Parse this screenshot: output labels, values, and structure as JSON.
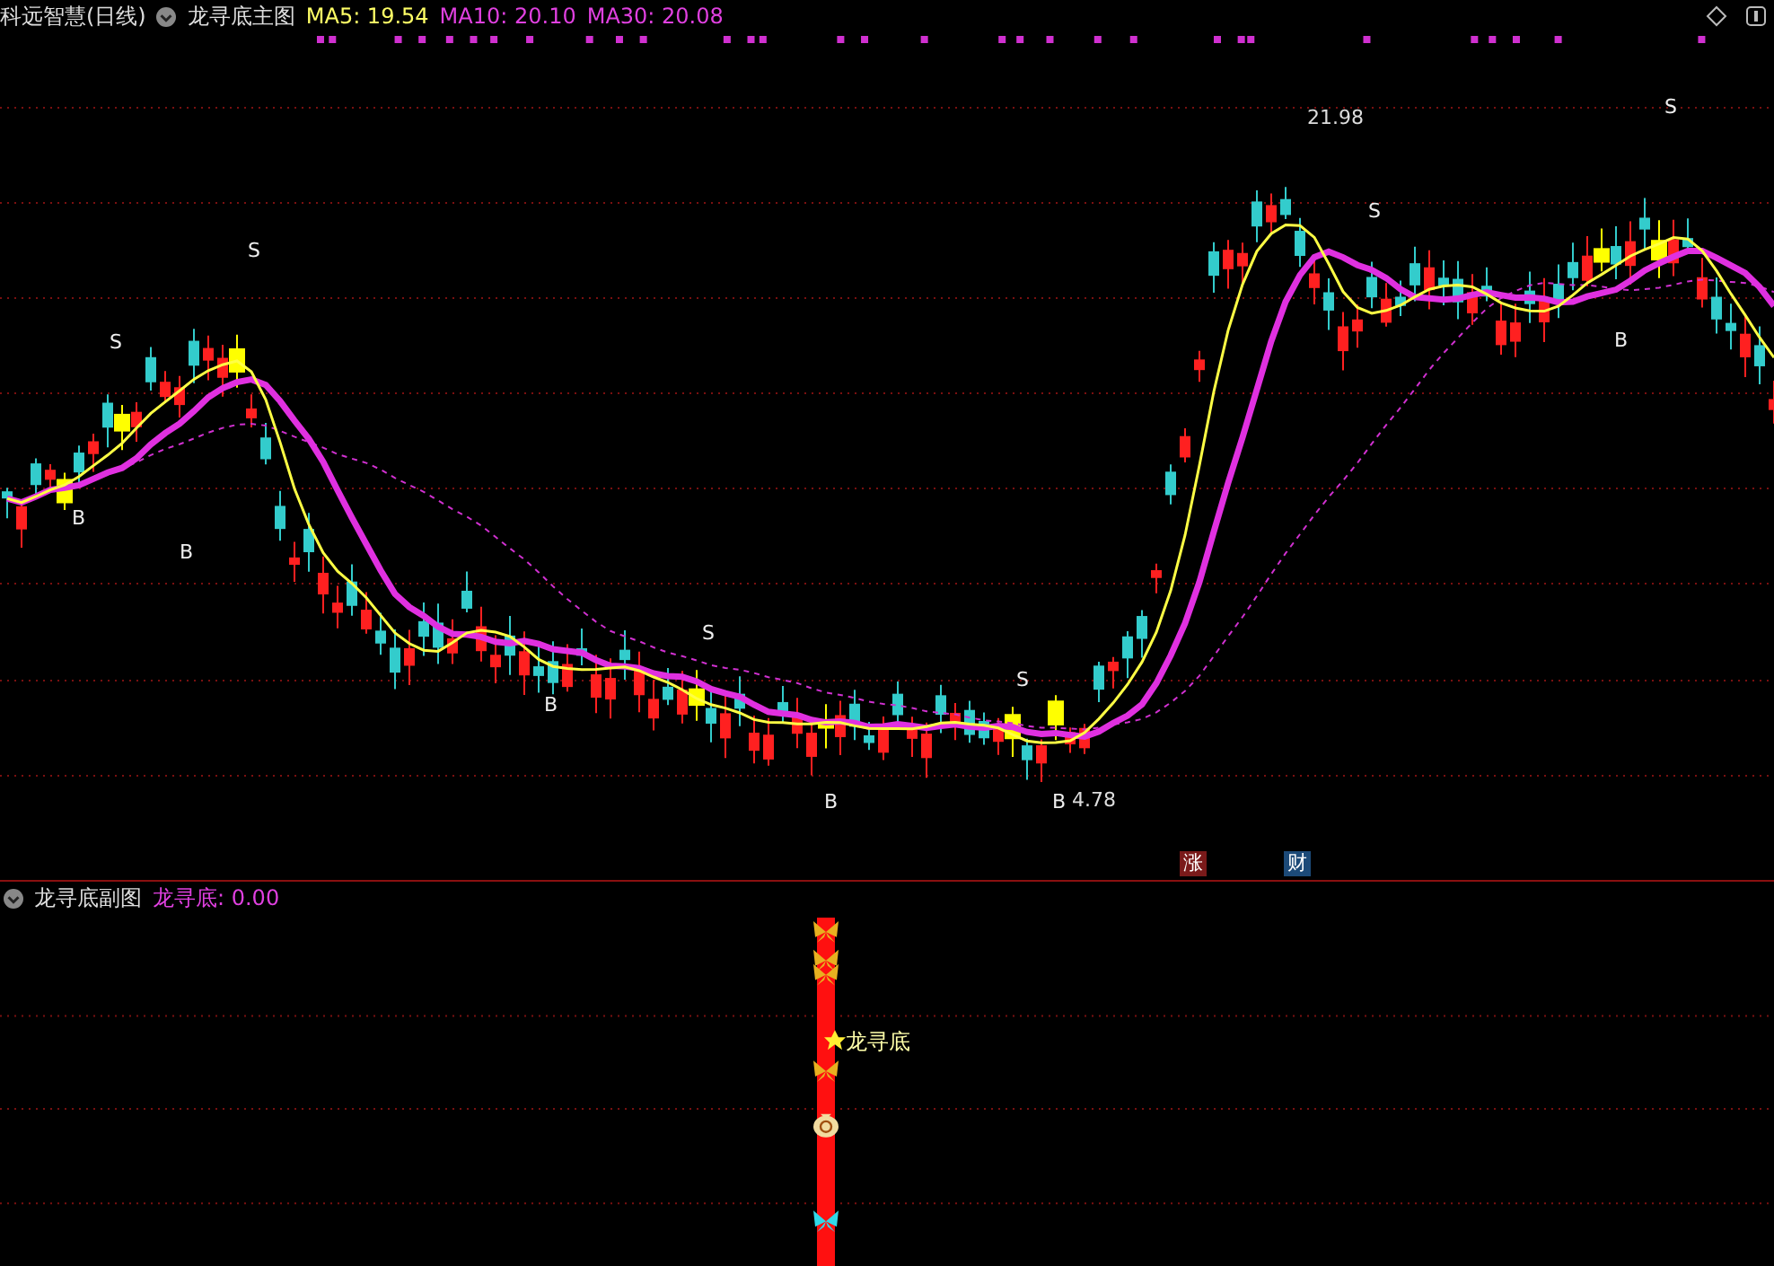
{
  "main_panel": {
    "title": "科远智慧(日线)",
    "indicator": "龙寻底主图",
    "readouts": [
      {
        "label": "MA5: 19.54",
        "color": "#ffff66"
      },
      {
        "label": "MA10: 20.10",
        "color": "#e040e0"
      },
      {
        "label": "MA30: 20.08",
        "color": "#e040e0"
      }
    ],
    "signals": [
      {
        "text": "S"
      },
      {
        "text": "S"
      },
      {
        "text": "B"
      },
      {
        "text": "B"
      },
      {
        "text": "S"
      },
      {
        "text": "B"
      },
      {
        "text": "B"
      },
      {
        "text": "S"
      },
      {
        "text": "B"
      },
      {
        "text": "S"
      },
      {
        "text": "S"
      },
      {
        "text": "B"
      }
    ],
    "high_label": "21.98",
    "low_label": "4.78",
    "badges": [
      {
        "text": "涨",
        "color": "#7a1a1a"
      },
      {
        "text": "财",
        "color": "#1c4a78"
      }
    ]
  },
  "sub_panel": {
    "indicator": "龙寻底副图",
    "readouts": [
      {
        "label": "龙寻底: 0.00",
        "color": "#e040e0"
      }
    ],
    "marker_label": "龙寻底"
  }
}
